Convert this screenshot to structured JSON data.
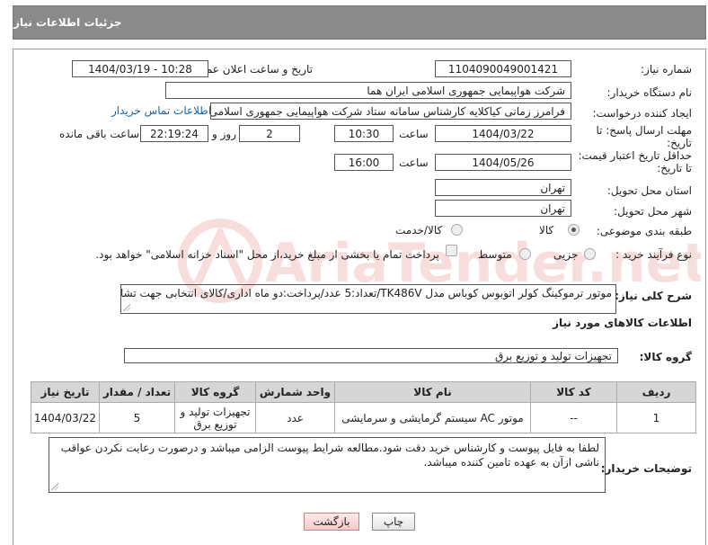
{
  "header": {
    "title": "جزئیات اطلاعات نیاز"
  },
  "form": {
    "need_number_label": "شماره نیاز:",
    "need_number": "1104090049001421",
    "announce_label": "تاریخ و ساعت اعلان عمومی:",
    "announce_value": "1404/03/19 - 10:28",
    "buyer_org_label": "نام دستگاه خریدار:",
    "buyer_org": "شرکت هواپیمایی جمهوری اسلامی ایران هما",
    "creator_label": "ایجاد کننده درخواست:",
    "creator": "فرامرز زمانی کیاکلایه کارشناس سامانه ستاد شرکت هواپیمایی جمهوری اسلامی ایران هما",
    "buyer_contact_link": "اطلاعات تماس خریدار",
    "deadline_label_1": "مهلت ارسال پاسخ: تا",
    "deadline_label_2": "تاریخ:",
    "deadline_date": "1404/03/22",
    "time_label": "ساعت",
    "deadline_time": "10:30",
    "days_value": "2",
    "days_label": "روز و",
    "remaining_value": "22:19:24",
    "remaining_label": "ساعت باقی مانده",
    "validity_label_1": "حداقل تاریخ اعتبار قیمت:",
    "validity_label_2": "تا تاریخ:",
    "validity_date": "1404/05/26",
    "validity_time": "16:00",
    "province_label": "استان محل تحویل:",
    "province": "تهران",
    "city_label": "شهر محل تحویل:",
    "city": "تهران",
    "category_label": "طبقه بندی موضوعی:",
    "category_options": [
      "کالا",
      "کالا/خدمت"
    ],
    "category_selected": "کالا",
    "process_label": "نوع فرآیند خرید :",
    "process_options": [
      "جزیی",
      "متوسط"
    ],
    "process_note": "پرداخت تمام یا بخشی از مبلغ خرید،از محل \"اسناد خزانه اسلامی\" خواهد بود.",
    "description_label": "شرح کلی نیاز:",
    "description": "موتور ترموکینگ کولر اتوبوس کوباس مدل TK486V/تعداد:5 عدد/پرداخت:دو ماه اداری/کالای انتخابی جهت تشابه"
  },
  "goods": {
    "section_title": "اطلاعات کالاهای مورد نیاز",
    "group_label": "گروه کالا:",
    "group_value": "تجهیزات تولید و توزیع برق",
    "columns": [
      "ردیف",
      "کد کالا",
      "نام کالا",
      "واحد شمارش",
      "گروه کالا",
      "تعداد / مقدار",
      "تاریخ نیاز"
    ],
    "rows": [
      {
        "row": "1",
        "code": "--",
        "name": "موتور AC سیستم گرمایشی و سرمایشی",
        "unit": "عدد",
        "group": "تجهیزات تولید و توزیع برق",
        "qty": "5",
        "date": "1404/03/22"
      }
    ]
  },
  "notes": {
    "label": "توضیحات خریدار:",
    "text": "لطفا به فایل پیوست و کارشناس خرید دقت شود.مطالعه شرایط پیوست الزامی میباشد و درصورت رعایت نکردن عواقب ناشی ازآن به عهده تامین کننده میباشد."
  },
  "buttons": {
    "print": "چاپ",
    "back": "بازگشت"
  },
  "watermark": {
    "text": "AriaTender.net"
  },
  "colors": {
    "header_bg": "#8a8a8a",
    "link": "#1a64a8",
    "table_header": "#d6d6d6",
    "back_button": "#f5c9c9"
  }
}
